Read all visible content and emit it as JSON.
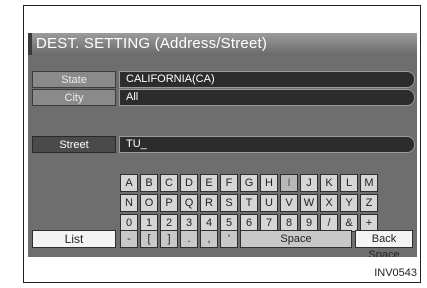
{
  "title": "DEST. SETTING (Address/Street)",
  "state": {
    "label": "State",
    "value": "CALIFORNIA(CA)"
  },
  "city": {
    "label": "City",
    "value": "All"
  },
  "street": {
    "label": "Street",
    "value": "TU_"
  },
  "keyboard": {
    "rows": [
      [
        "A",
        "B",
        "C",
        "D",
        "E",
        "F",
        "G",
        "H",
        "I",
        "J",
        "K",
        "L",
        "M"
      ],
      [
        "N",
        "O",
        "P",
        "Q",
        "R",
        "S",
        "T",
        "U",
        "V",
        "W",
        "X",
        "Y",
        "Z"
      ],
      [
        "0",
        "1",
        "2",
        "3",
        "4",
        "5",
        "6",
        "7",
        "8",
        "9",
        "/",
        "&",
        "+"
      ]
    ],
    "dimmed_keys": [
      "I"
    ],
    "bottom_row": {
      "dash": "-",
      "open_bracket": "[",
      "close_bracket": "]",
      "period": ".",
      "comma": ",",
      "apostrophe": "'"
    },
    "space_label": "Space",
    "backspace_label": "Back Space"
  },
  "list_button": {
    "label": "List"
  },
  "image_code": "INV0543"
}
